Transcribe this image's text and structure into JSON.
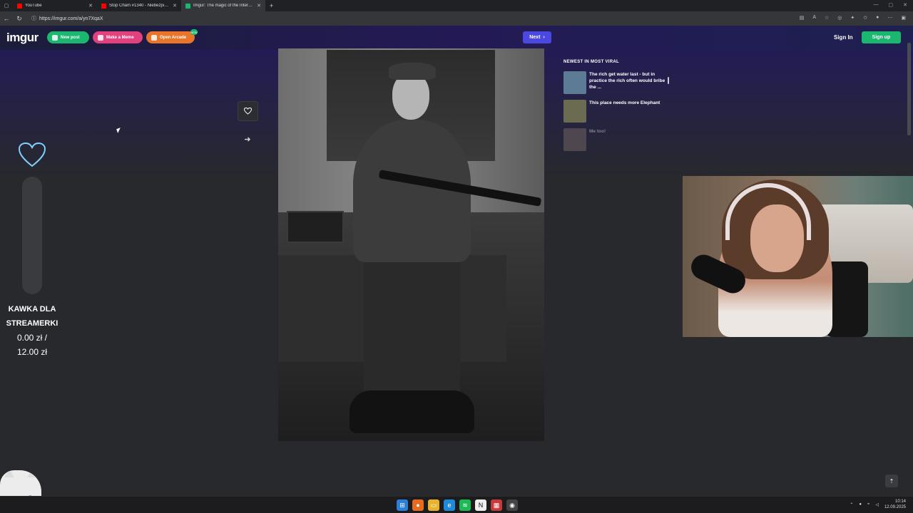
{
  "browser": {
    "tabs": [
      {
        "label": "YouTube",
        "color": "#ff0000"
      },
      {
        "label": "Stop Cham #1340 - Niebezpieczn...",
        "color": "#ff0000"
      },
      {
        "label": "Imgur: The magic of the Internet",
        "color": "#1bb76e",
        "active": true
      }
    ],
    "new_tab": "+",
    "url": "https://imgur.com/a/yn7XqaX"
  },
  "header": {
    "logo": "imgur",
    "new_post": "New post",
    "make_meme": "Make a Meme",
    "open_arcade": "Open Arcade",
    "arcade_badge": "NEW",
    "next": "Next",
    "sign_in": "Sign In",
    "sign_up": "Sign up"
  },
  "donation": {
    "line1": "KAWKA DLA",
    "line2": "STREAMERKI",
    "current": "0.00 zł /",
    "goal": "12.00 zł",
    "progress_fraction": 0.0
  },
  "sidebar": {
    "title": "NEWEST IN MOST VIRAL",
    "items": [
      {
        "title": "The rich get water last - but in practice the rich often would bribe the ...",
        "thumb_color": "#5e7b95"
      },
      {
        "title": "This place needs more Elephant",
        "thumb_color": "#6b6b52"
      },
      {
        "title": "Me too!",
        "thumb_color": "#8a7a72"
      }
    ]
  },
  "taskbar": {
    "time": "10:14",
    "date": "12.09.2025"
  },
  "colors": {
    "brand_green": "#1bb76e",
    "meme_pink": "#e3417d",
    "arcade_orange": "#e8752a",
    "next_blue": "#4a48e0"
  }
}
